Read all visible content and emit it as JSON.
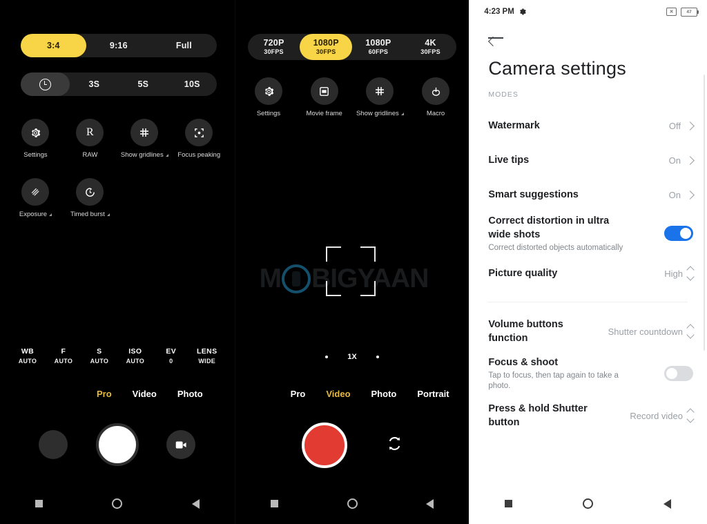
{
  "panel_pro": {
    "aspect_ratio": {
      "options": [
        {
          "label": "3:4",
          "selected": true
        },
        {
          "label": "9:16",
          "selected": false
        },
        {
          "label": "Full",
          "selected": false
        }
      ]
    },
    "timer": {
      "options": [
        {
          "label": "",
          "icon": "timer-clock-icon",
          "selected": true
        },
        {
          "label": "3S",
          "selected": false
        },
        {
          "label": "5S",
          "selected": false
        },
        {
          "label": "10S",
          "selected": false
        }
      ]
    },
    "tools_row1": [
      {
        "label": "Settings",
        "icon": "gear-icon",
        "has_caret": false
      },
      {
        "label": "RAW",
        "icon": "raw-icon",
        "has_caret": false
      },
      {
        "label": "Show gridlines",
        "icon": "grid-icon",
        "has_caret": true
      },
      {
        "label": "Focus peaking",
        "icon": "focus-peaking-icon",
        "has_caret": false
      }
    ],
    "tools_row2": [
      {
        "label": "Exposure",
        "icon": "exposure-icon",
        "has_caret": true
      },
      {
        "label": "Timed burst",
        "icon": "timed-burst-icon",
        "has_caret": true
      }
    ],
    "pro_bar": [
      {
        "key": "WB",
        "value": "AUTO"
      },
      {
        "key": "F",
        "value": "AUTO"
      },
      {
        "key": "S",
        "value": "AUTO"
      },
      {
        "key": "ISO",
        "value": "AUTO"
      },
      {
        "key": "EV",
        "value": "0"
      },
      {
        "key": "LENS",
        "value": "WIDE"
      }
    ],
    "modes": [
      {
        "label": "Pro",
        "active": true
      },
      {
        "label": "Video",
        "active": false
      },
      {
        "label": "Photo",
        "active": false
      }
    ],
    "shutter": {
      "gallery_thumb": "gallery-thumbnail",
      "shutter_button": "shutter-button",
      "switch_button_icon": "video-camera-icon"
    }
  },
  "panel_video": {
    "resolution": {
      "options": [
        {
          "main": "720P",
          "sub": "30FPS",
          "selected": false
        },
        {
          "main": "1080P",
          "sub": "30FPS",
          "selected": true
        },
        {
          "main": "1080P",
          "sub": "60FPS",
          "selected": false
        },
        {
          "main": "4K",
          "sub": "30FPS",
          "selected": false
        }
      ]
    },
    "tools_row1": [
      {
        "label": "Settings",
        "icon": "gear-icon",
        "has_caret": false
      },
      {
        "label": "Movie frame",
        "icon": "movie-frame-icon",
        "has_caret": false
      },
      {
        "label": "Show gridlines",
        "icon": "grid-icon",
        "has_caret": true
      },
      {
        "label": "Macro",
        "icon": "macro-icon",
        "has_caret": false
      }
    ],
    "zoom": {
      "label": "1X"
    },
    "modes": [
      {
        "label": "Pro",
        "active": false
      },
      {
        "label": "Video",
        "active": true
      },
      {
        "label": "Photo",
        "active": false
      },
      {
        "label": "Portrait",
        "active": false
      }
    ],
    "record_button": "record-button",
    "switch_camera_icon": "switch-camera-icon",
    "watermark_text": "M BIGYAAN"
  },
  "panel_settings": {
    "status_bar": {
      "time": "4:23 PM",
      "gear_icon": "gear-icon",
      "silent_icon": "silent-mode-icon",
      "battery_level": "47"
    },
    "back_icon": "back-arrow-icon",
    "title": "Camera settings",
    "section_label": "MODES",
    "rows": [
      {
        "title": "Watermark",
        "sub": "",
        "value": "Off",
        "control": "chevron"
      },
      {
        "title": "Live tips",
        "sub": "",
        "value": "On",
        "control": "chevron"
      },
      {
        "title": "Smart suggestions",
        "sub": "",
        "value": "On",
        "control": "chevron"
      },
      {
        "title": "Correct distortion in ultra wide shots",
        "sub": "Correct distorted objects automatically",
        "value": "",
        "control": "toggle-on"
      },
      {
        "title": "Picture quality",
        "sub": "",
        "value": "High",
        "control": "updown"
      },
      {
        "title": "Volume buttons function",
        "sub": "",
        "value": "Shutter countdown",
        "control": "updown"
      },
      {
        "title": "Focus & shoot",
        "sub": "Tap to focus, then tap again to take a photo.",
        "value": "",
        "control": "toggle-off"
      },
      {
        "title": "Press & hold Shutter button",
        "sub": "",
        "value": "Record video",
        "control": "updown"
      }
    ]
  },
  "colors": {
    "accent_yellow": "#f8d547",
    "mode_active": "#e8b93b",
    "toggle_on": "#1a73e8",
    "record_red": "#e23b32"
  }
}
